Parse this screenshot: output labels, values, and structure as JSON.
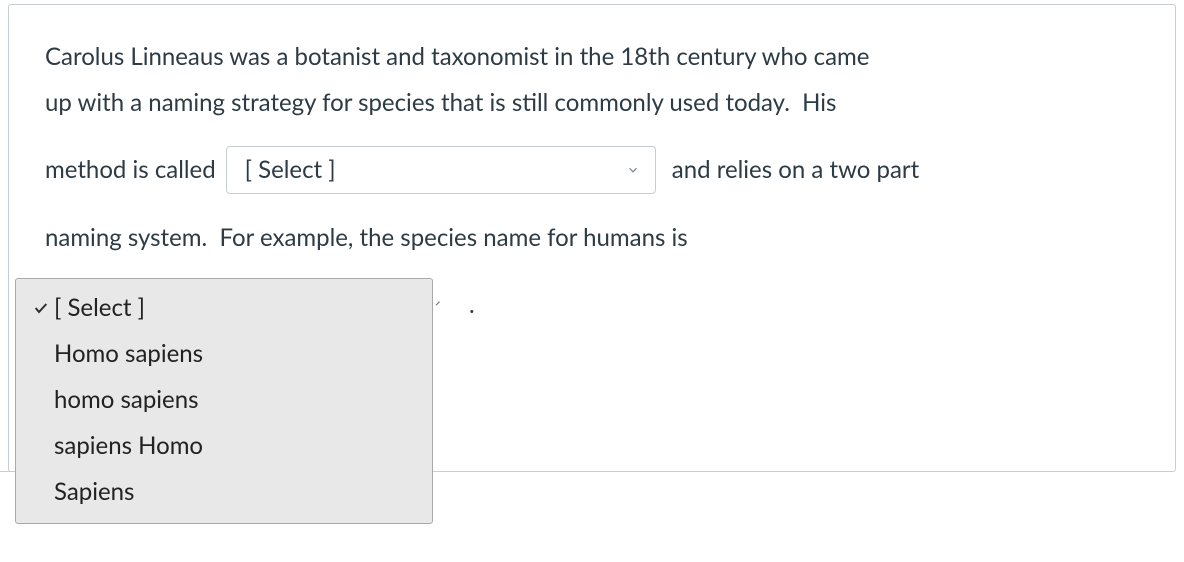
{
  "question": {
    "part1a": "Carolus Linneaus was a botanist and taxonomist in the 18th century who came",
    "part1b": "up with a naming strategy for species that is still commonly used today.  His",
    "part2a": "method is called",
    "part2b": " and relies on a two part",
    "part3": "naming system.  For example, the species name for humans is",
    "period": "."
  },
  "select1": {
    "placeholder": "[ Select ]"
  },
  "dropdown": {
    "items": [
      {
        "label": "[ Select ]",
        "selected": true
      },
      {
        "label": "Homo sapiens",
        "selected": false
      },
      {
        "label": "homo sapiens",
        "selected": false
      },
      {
        "label": "sapiens Homo",
        "selected": false
      },
      {
        "label": "Sapiens",
        "selected": false
      }
    ]
  }
}
